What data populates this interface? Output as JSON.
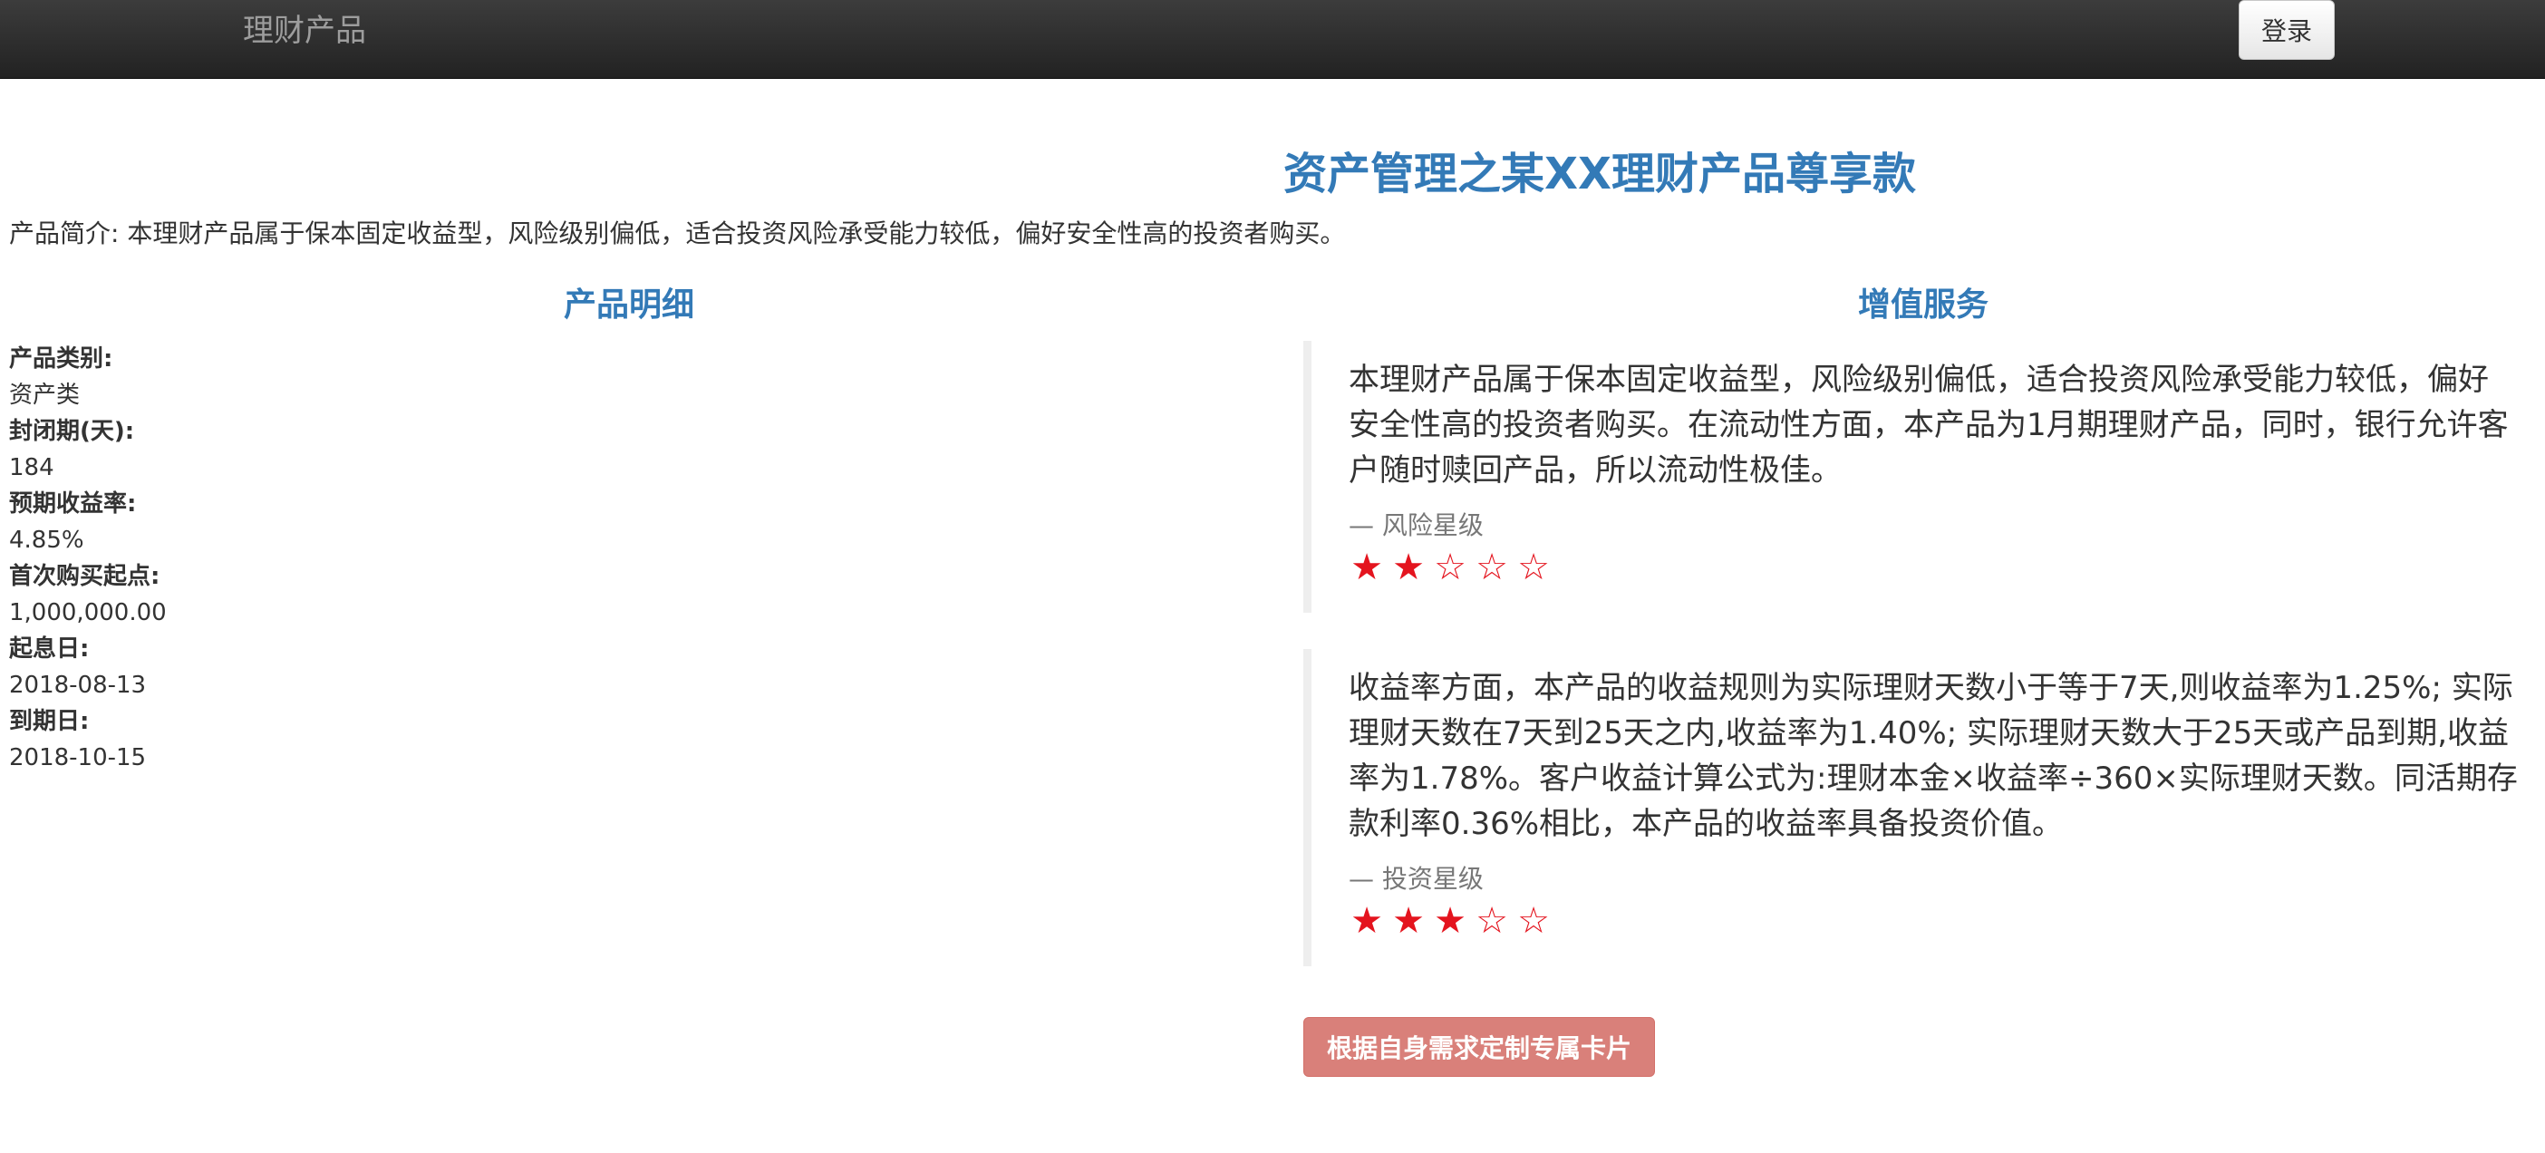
{
  "navbar": {
    "brand": "理财产品",
    "login_label": "登录"
  },
  "page": {
    "title": "资产管理之某XX理财产品尊享款",
    "intro": "产品简介: 本理财产品属于保本固定收益型，风险级别偏低，适合投资风险承受能力较低，偏好安全性高的投资者购买。"
  },
  "details": {
    "heading": "产品明细",
    "items": [
      {
        "label": "产品类别:",
        "value": "资产类"
      },
      {
        "label": "封闭期(天):",
        "value": "184"
      },
      {
        "label": "预期收益率:",
        "value": "4.85%"
      },
      {
        "label": "首次购买起点:",
        "value": "1,000,000.00"
      },
      {
        "label": "起息日:",
        "value": "2018-08-13"
      },
      {
        "label": "到期日:",
        "value": "2018-10-15"
      }
    ]
  },
  "services": {
    "heading": "增值服务",
    "quotes": [
      {
        "text": "本理财产品属于保本固定收益型，风险级别偏低，适合投资风险承受能力较低，偏好安全性高的投资者购买。在流动性方面，本产品为1月期理财产品，同时，银行允许客户随时赎回产品，所以流动性极佳。",
        "footer": "— 风险星级",
        "rating": 2,
        "rating_max": 5
      },
      {
        "text": "收益率方面，本产品的收益规则为实际理财天数小于等于7天,则收益率为1.25%; 实际理财天数在7天到25天之内,收益率为1.40%; 实际理财天数大于25天或产品到期,收益率为1.78%。客户收益计算公式为:理财本金×收益率÷360×实际理财天数。同活期存款利率0.36%相比，本产品的收益率具备投资价值。",
        "footer": "— 投资星级",
        "rating": 3,
        "rating_max": 5
      }
    ]
  },
  "custom_button_label": "根据自身需求定制专属卡片",
  "colors": {
    "accent": "#337ab7",
    "star": "#e4141e",
    "button": "#d9807a"
  }
}
